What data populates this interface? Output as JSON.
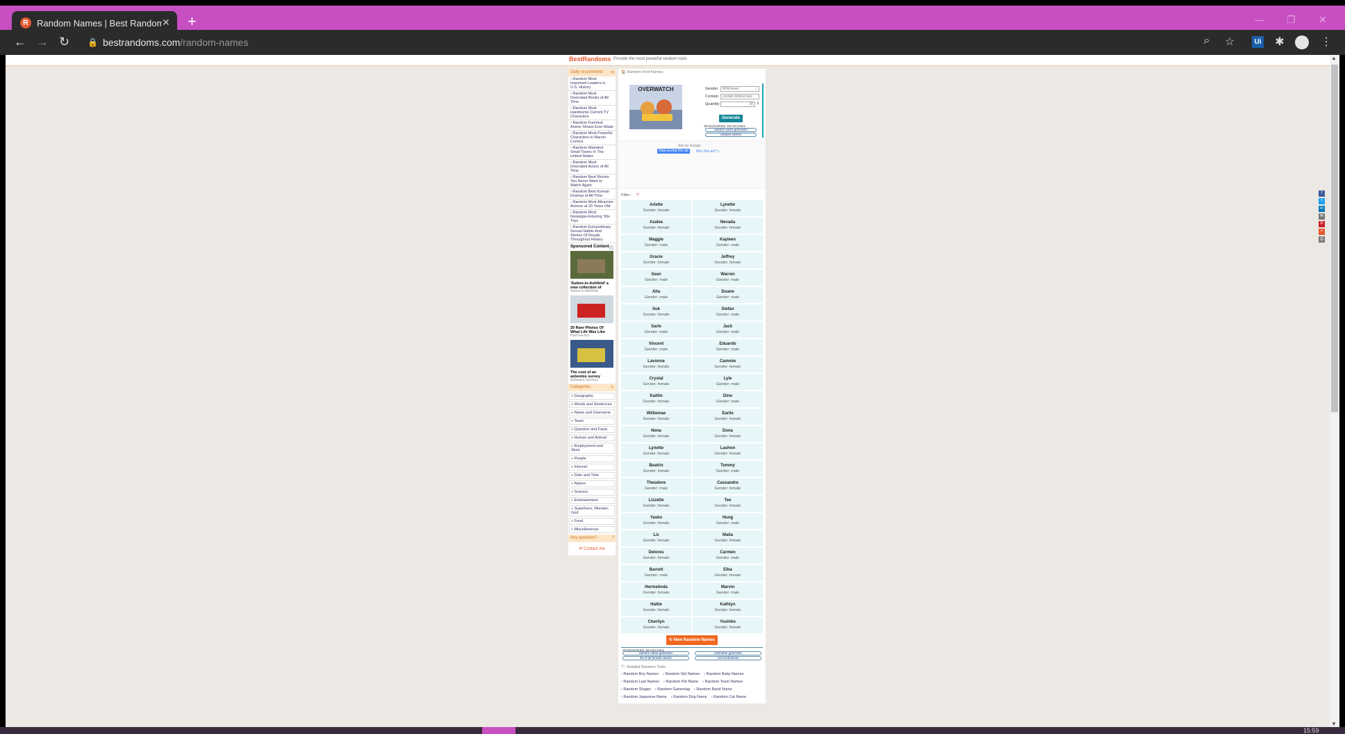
{
  "browser": {
    "tab_title": "Random Names | Best Random T",
    "favicon_letter": "R",
    "new_tab": "+",
    "url_host": "bestrandoms.com",
    "url_path": "/random-names",
    "ext_label": "Ui"
  },
  "site": {
    "logo": "BestRandoms",
    "slogan": "Provide the most powerful random tools"
  },
  "sidebar": {
    "daily_header": "Daily recommend",
    "daily_links": [
      "› Random Most Important Leaders in U.S. History",
      "› Random Most Overrated Books of All Time",
      "› Random Most Handsome Current TV Characters",
      "› Random Funniest Anime Shows Ever Made",
      "› Random Most Powerful Characters in Marvel Comics",
      "› Random Weirdest Small Towns In The United States",
      "› Random Most Overrated Actors of All Time",
      "› Random Best Movies You Never Want to Watch Again",
      "› Random Best Korean Dramas of All Time",
      "› Random Most Attractive Actress at 20 Years Old",
      "› Random Most Nostalgia-Inducing '90s Toys",
      "› Random Extraordinary Sexual Habits And Stories Of Royals Throughout History"
    ],
    "sponsored_title": "Sponsored Content",
    "sponsored": [
      {
        "caption": "'Sutton-in-Ashfield' a new collection of",
        "source": "Sutton-in-Ashfield"
      },
      {
        "caption": "20 Rare Photos Of What Life Was Like",
        "source": "Past Factory"
      },
      {
        "caption": "The cost of an asbestos survey",
        "source": "Asbestos Surveys"
      }
    ],
    "categories_header": "Categories",
    "categories": [
      "» Geography",
      "» Words and Sentences",
      "» Name and Username",
      "» Team",
      "» Question and Facts",
      "» Human and Animal",
      "» Employment and Work",
      "» People",
      "» Internet",
      "» Date and Time",
      "» Nature",
      "» Science",
      "» Entertainment",
      "» Superhero, Monster, God",
      "» Food",
      "» Miscellaneous"
    ],
    "question_header": "Any question?",
    "contact": "✉ Contact me"
  },
  "main": {
    "breadcrumb": "🏠 Random First Names",
    "game_title": "OVERWATCH",
    "form": {
      "gender_label": "Gender",
      "gender_value": "Whichever",
      "contain_label": "Contain",
      "contain_placeholder": "contain letters/case",
      "quantity_label": "Quantity",
      "quantity_value": "30",
      "generate": "Generate"
    },
    "sponsored_label": "SPONSORED SEARCHES",
    "sponsored_pills": [
      "random name generator",
      "random names"
    ],
    "ad": {
      "by": "Ads by Google",
      "stop": "Stop seeing this ad",
      "why": "Why this ad? ▷"
    },
    "filter_label": "Filter:",
    "names": [
      [
        {
          "n": "Arlette",
          "g": "Gender: female"
        },
        {
          "n": "Lynette",
          "g": "Gender: female"
        }
      ],
      [
        {
          "n": "Azalea",
          "g": "Gender: female"
        },
        {
          "n": "Nevada",
          "g": "Gender: female"
        }
      ],
      [
        {
          "n": "Maggie",
          "g": "Gender: male"
        },
        {
          "n": "Kayleen",
          "g": "Gender: male"
        }
      ],
      [
        {
          "n": "Gracie",
          "g": "Gender: female"
        },
        {
          "n": "Jeffrey",
          "g": "Gender: female"
        }
      ],
      [
        {
          "n": "Sean",
          "g": "Gender: male"
        },
        {
          "n": "Warren",
          "g": "Gender: male"
        }
      ],
      [
        {
          "n": "Alta",
          "g": "Gender: male"
        },
        {
          "n": "Duane",
          "g": "Gender: male"
        }
      ],
      [
        {
          "n": "Suk",
          "g": "Gender: female"
        },
        {
          "n": "Stefan",
          "g": "Gender: male"
        }
      ],
      [
        {
          "n": "Sarle",
          "g": "Gender: male"
        },
        {
          "n": "Jack",
          "g": "Gender: male"
        }
      ],
      [
        {
          "n": "Vincent",
          "g": "Gender: male"
        },
        {
          "n": "Eduardo",
          "g": "Gender: male"
        }
      ],
      [
        {
          "n": "Lavonne",
          "g": "Gender: female"
        },
        {
          "n": "Cammie",
          "g": "Gender: female"
        }
      ],
      [
        {
          "n": "Crystal",
          "g": "Gender: female"
        },
        {
          "n": "Lyle",
          "g": "Gender: male"
        }
      ],
      [
        {
          "n": "Kaitlin",
          "g": "Gender: female"
        },
        {
          "n": "Dino",
          "g": "Gender: male"
        }
      ],
      [
        {
          "n": "Williemae",
          "g": "Gender: female"
        },
        {
          "n": "Earlie",
          "g": "Gender: female"
        }
      ],
      [
        {
          "n": "Nena",
          "g": "Gender: female"
        },
        {
          "n": "Dona",
          "g": "Gender: female"
        }
      ],
      [
        {
          "n": "Lynette",
          "g": "Gender: female"
        },
        {
          "n": "Lashon",
          "g": "Gender: female"
        }
      ],
      [
        {
          "n": "Beatrix",
          "g": "Gender: female"
        },
        {
          "n": "Tommy",
          "g": "Gender: male"
        }
      ],
      [
        {
          "n": "Theodore",
          "g": "Gender: male"
        },
        {
          "n": "Cassandre",
          "g": "Gender: female"
        }
      ],
      [
        {
          "n": "Lizzette",
          "g": "Gender: female"
        },
        {
          "n": "Tee",
          "g": "Gender: female"
        }
      ],
      [
        {
          "n": "Yasko",
          "g": "Gender: female"
        },
        {
          "n": "Hung",
          "g": "Gender: male"
        }
      ],
      [
        {
          "n": "Liz",
          "g": "Gender: female"
        },
        {
          "n": "Malia",
          "g": "Gender: female"
        }
      ],
      [
        {
          "n": "Delores",
          "g": "Gender: female"
        },
        {
          "n": "Carmen",
          "g": "Gender: male"
        }
      ],
      [
        {
          "n": "Barrett",
          "g": "Gender: male"
        },
        {
          "n": "Elba",
          "g": "Gender: female"
        }
      ],
      [
        {
          "n": "Hermelinda",
          "g": "Gender: female"
        },
        {
          "n": "Marvin",
          "g": "Gender: male"
        }
      ],
      [
        {
          "n": "Hattie",
          "g": "Gender: female"
        },
        {
          "n": "Kathlyn",
          "g": "Gender: female"
        }
      ],
      [
        {
          "n": "Cherilyn",
          "g": "Gender: female"
        },
        {
          "n": "Yoshiko",
          "g": "Gender: female"
        }
      ]
    ],
    "new_names": "↻ New Random Names",
    "sponsored2_label": "SPONSORED SEARCHES",
    "sponsored2_pills": [
      "random name generator",
      "nickname generator",
      "list of all female names",
      "cool nicknames"
    ],
    "related_header": "🏷 Related Random Tools",
    "related": [
      "› Random Boy Names",
      "› Random Girl Names",
      "› Random Baby Names",
      "› Random Last Names",
      "› Random Pet Name",
      "› Random Team Names",
      "› Random Slogan",
      "› Random Gamertag",
      "› Random Band Name",
      "› Random Japanese Name",
      "› Random Dog Name",
      "› Random Cat Name"
    ]
  },
  "share": [
    "f",
    "t",
    "in",
    "✉",
    "P",
    "+",
    "⎙"
  ],
  "share_colors": [
    "#3b5998",
    "#1da1f2",
    "#0077b5",
    "#777777",
    "#cb2027",
    "#e4572e",
    "#777777"
  ],
  "taskbar": {
    "clock": "15:59"
  },
  "colors": {
    "accent": "#c74fc2",
    "brand": "#e4572e",
    "teal": "#14869a"
  }
}
